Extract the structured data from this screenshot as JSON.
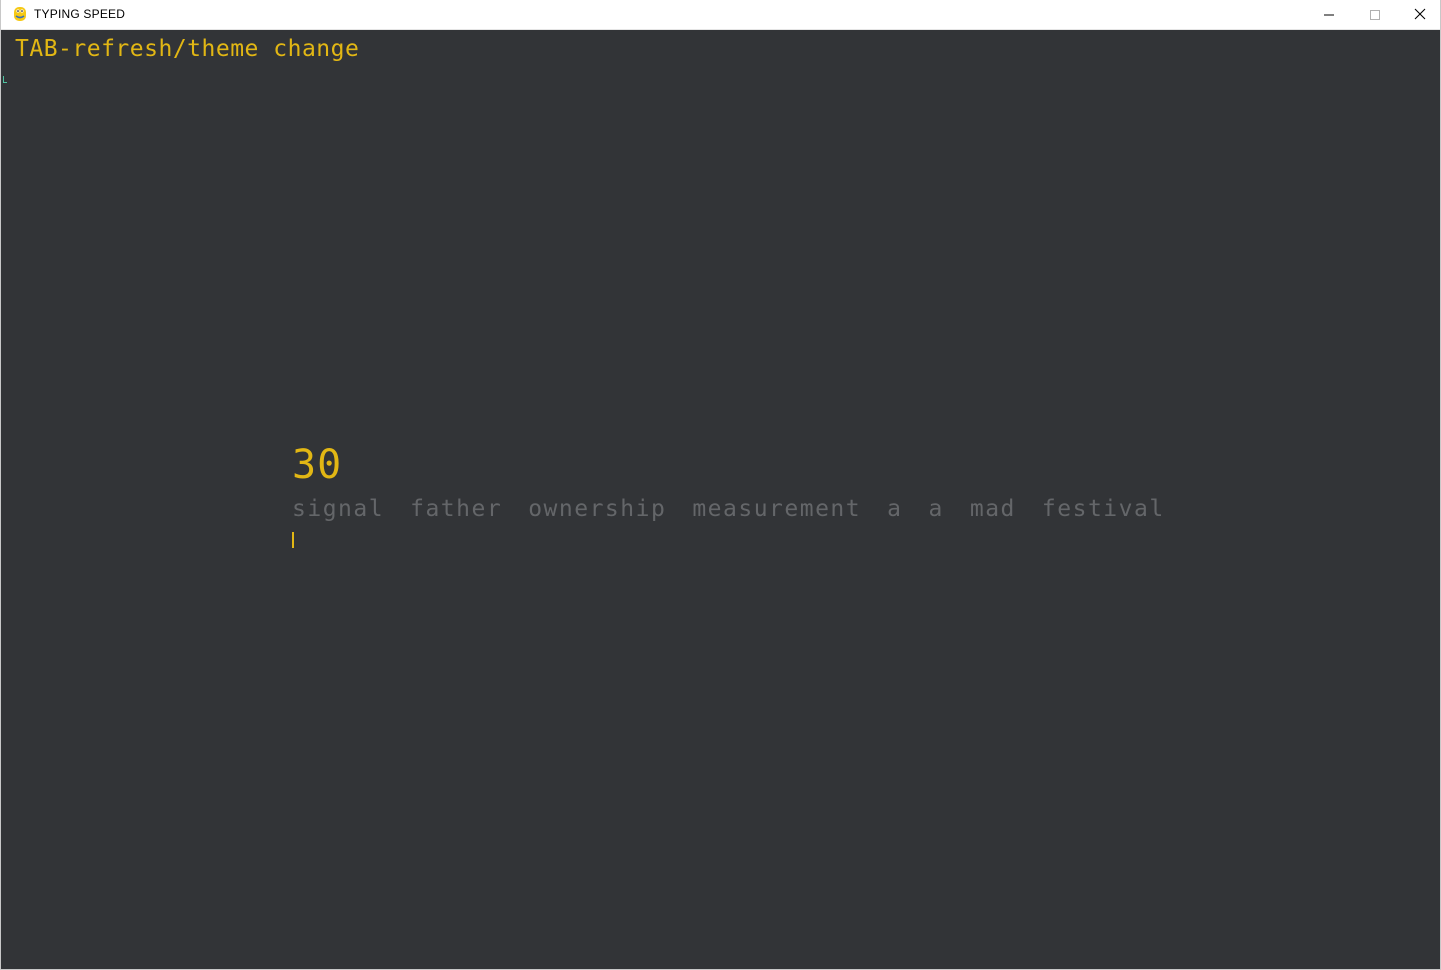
{
  "window": {
    "title": "TYPING SPEED",
    "app_icon": "pygame-snake-icon",
    "controls": {
      "minimize": "minimize-icon",
      "maximize": "maximize-icon",
      "close": "close-icon"
    }
  },
  "game": {
    "hint": "TAB-refresh/theme change",
    "timer": "30",
    "words": [
      "signal",
      "father",
      "ownership",
      "measurement",
      "a",
      "a",
      "mad",
      "festival"
    ]
  },
  "colors": {
    "background": "#323437",
    "accent": "#e2b714",
    "untyped_text": "#646669"
  }
}
